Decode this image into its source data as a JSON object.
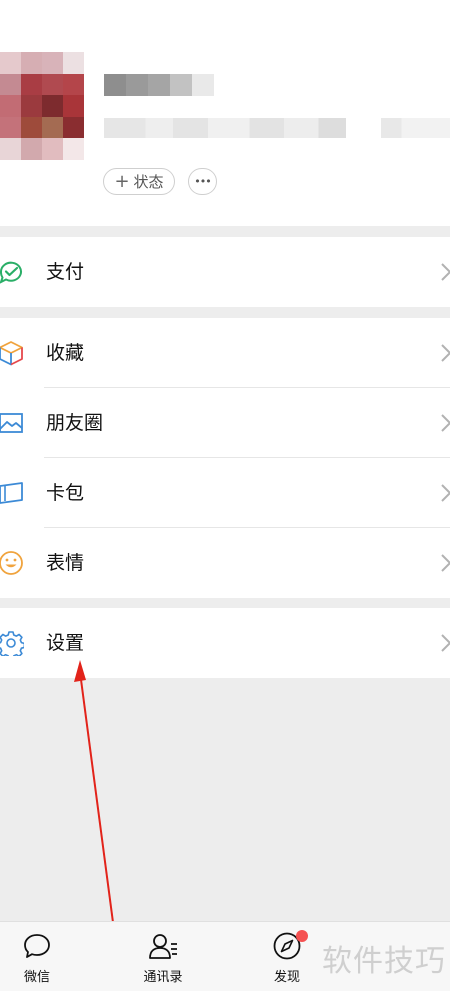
{
  "profile": {
    "status_label": "状态",
    "status_plus": "+",
    "more_label": "•••"
  },
  "groups": {
    "pay": [
      {
        "label": "支付",
        "icon": "wechat-pay-icon"
      }
    ],
    "tools": [
      {
        "label": "收藏",
        "icon": "cube-icon"
      },
      {
        "label": "朋友圈",
        "icon": "image-icon"
      },
      {
        "label": "卡包",
        "icon": "card-icon"
      },
      {
        "label": "表情",
        "icon": "smiley-icon"
      }
    ],
    "settings": [
      {
        "label": "设置",
        "icon": "gear-icon"
      }
    ]
  },
  "tabbar": [
    {
      "label": "微信",
      "icon": "chat-bubble-icon"
    },
    {
      "label": "通讯录",
      "icon": "contacts-icon"
    },
    {
      "label": "发现",
      "icon": "compass-icon"
    }
  ],
  "watermark": "软件技巧",
  "colors": {
    "pay_green": "#2aae67",
    "blue": "#3c8ad6",
    "smiley_orange": "#f0a33d",
    "badge_red": "#f55151",
    "annotation_red": "#e2231a"
  }
}
